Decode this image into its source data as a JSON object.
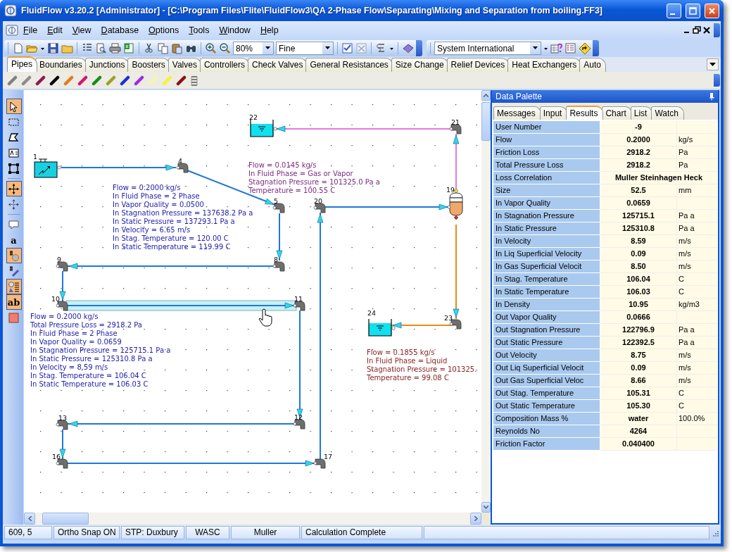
{
  "window": {
    "title": "FluidFlow v3.20.2 [Administrator] - [C:\\Program Files\\Flite\\FluidFlow3\\QA 2-Phase Flow\\Separating\\Mixing and Separation from boiling.FF3]"
  },
  "menu": [
    "File",
    "Edit",
    "View",
    "Database",
    "Options",
    "Tools",
    "Window",
    "Help"
  ],
  "toolbar": {
    "zoom": "80%",
    "grid": "Fine",
    "units": "System International"
  },
  "component_tabs": [
    {
      "label": "Pipes",
      "selected": true
    },
    {
      "label": "Boundaries",
      "selected": false
    },
    {
      "label": "Junctions",
      "selected": false
    },
    {
      "label": "Boosters",
      "selected": false
    },
    {
      "label": "Valves",
      "selected": false
    },
    {
      "label": "Controllers",
      "selected": false
    },
    {
      "label": "Check Valves",
      "selected": false
    },
    {
      "label": "General Resistances",
      "selected": false
    },
    {
      "label": "Size Change",
      "selected": false
    },
    {
      "label": "Relief Devices",
      "selected": false
    },
    {
      "label": "Heat Exchangers",
      "selected": false
    },
    {
      "label": "Auto",
      "selected": false
    }
  ],
  "pipe_palette": [
    {
      "color": "#808080"
    },
    {
      "color": "#8c8c8c"
    },
    {
      "color": "#8b1a4a"
    },
    {
      "color": "#000000"
    },
    {
      "color": "#e07b1c"
    },
    {
      "color": "#d4156f"
    },
    {
      "color": "#1a8a1a"
    },
    {
      "color": "#a0a020"
    },
    {
      "color": "#1f2fd0"
    },
    {
      "color": "#9b2de0"
    },
    {
      "color": "#f5f5b0"
    },
    {
      "color": "#f5f530"
    },
    {
      "color": "#8b1010"
    }
  ],
  "tools": [
    {
      "on": true
    },
    {
      "on": false
    },
    {
      "on": false
    },
    {
      "on": false
    },
    {
      "on": false
    },
    {
      "on": true
    },
    {
      "on": false
    },
    {
      "on": false
    },
    {
      "on": false,
      "glyph": "a"
    },
    {
      "on": true
    },
    {
      "on": false
    },
    {
      "on": true
    },
    {
      "on": true,
      "glyph": "ab"
    },
    {
      "on": false
    }
  ],
  "diagram": {
    "nodes": [
      {
        "kind": "source",
        "label": "1"
      },
      {
        "kind": "elbow",
        "label": "4"
      },
      {
        "kind": "elbow",
        "label": "5"
      },
      {
        "kind": "elbow",
        "label": "8"
      },
      {
        "kind": "elbow",
        "label": "9"
      },
      {
        "kind": "elbow",
        "label": "10"
      },
      {
        "kind": "elbow",
        "label": "11"
      },
      {
        "kind": "elbow",
        "label": "12"
      },
      {
        "kind": "elbow",
        "label": "13"
      },
      {
        "kind": "elbow",
        "label": "16"
      },
      {
        "kind": "elbow",
        "label": "17"
      },
      {
        "kind": "elbow",
        "label": "20"
      },
      {
        "kind": "separator",
        "label": "19"
      },
      {
        "kind": "elbow",
        "label": "21"
      },
      {
        "kind": "tank",
        "label": "22"
      },
      {
        "kind": "elbow",
        "label": "23"
      },
      {
        "kind": "tank",
        "label": "24"
      }
    ],
    "pipes": [
      {
        "color": "#1e78d7",
        "selected": false
      },
      {
        "color": "#1e78d7",
        "selected": false
      },
      {
        "color": "#1e78d7",
        "selected": false
      },
      {
        "color": "#1e78d7",
        "selected": false
      },
      {
        "color": "#1e78d7",
        "selected": false
      },
      {
        "color": "#1e78d7",
        "selected": true
      },
      {
        "color": "#1e78d7",
        "selected": false
      },
      {
        "color": "#1e78d7",
        "selected": false
      },
      {
        "color": "#1e78d7",
        "selected": false
      },
      {
        "color": "#1e78d7",
        "selected": false
      },
      {
        "color": "#1e78d7",
        "selected": false
      },
      {
        "color": "#1e78d7",
        "selected": false
      },
      {
        "color": "#e27be0",
        "selected": false
      },
      {
        "color": "#e27be0",
        "selected": false
      },
      {
        "color": "#e88a1a",
        "selected": false
      },
      {
        "color": "#e88a1a",
        "selected": false
      }
    ],
    "annotations": [
      {
        "color": "#1c1ca8",
        "lines": [
          "Flow = 0.2000 kg/s",
          "In Fluid Phase = 2 Phase",
          "In Vapor Quality = 0.0500",
          "In Stagnation Pressure = 137638.2 Pa a",
          "In Static Pressure = 137293.1 Pa a",
          "In Velocity = 6.65 m/s",
          "In Stag. Temperature = 120.00 C",
          "In Static Temperature = 119.99 C"
        ]
      },
      {
        "color": "#7a2a82",
        "lines": [
          "Flow = 0.0145 kg/s",
          "In Fluid Phase = Gas or Vapor",
          "Stagnation Pressure = 101325.0 Pa a",
          "Temperature = 100.55 C"
        ]
      },
      {
        "color": "#1c1ca8",
        "lines": [
          "Flow = 0.2000 kg/s",
          "Total Pressure Loss = 2918.2 Pa",
          "In Fluid Phase = 2 Phase",
          "In Vapor Quality = 0.0659",
          "In Stagnation Pressure = 125715.1 Pa a",
          "In Static Pressure = 125310.8 Pa a",
          "In Velocity = 8.59 m/s",
          "In Stag. Temperature = 106.04 C",
          "In Static Temperature = 106.03 C"
        ]
      },
      {
        "color": "#8b2323",
        "lines": [
          "Flow = 0.1855 kg/s",
          "In Fluid Phase = Liquid",
          "Stagnation Pressure = 101325.",
          "Temperature = 99.08 C"
        ]
      }
    ]
  },
  "data_palette": {
    "title": "Data Palette",
    "tabs": [
      {
        "label": "Messages",
        "selected": false
      },
      {
        "label": "Input",
        "selected": false
      },
      {
        "label": "Results",
        "selected": true
      },
      {
        "label": "Chart",
        "selected": false
      },
      {
        "label": "List",
        "selected": false
      },
      {
        "label": "Watch",
        "selected": false
      }
    ],
    "rows": [
      {
        "kind": "value",
        "label": "User Number",
        "value": "-9"
      },
      {
        "kind": "value",
        "label": "Flow",
        "value": "0.2000",
        "unit": "kg/s"
      },
      {
        "kind": "value",
        "label": "Friction Loss",
        "value": "2918.2",
        "unit": "Pa"
      },
      {
        "kind": "value",
        "label": "Total Pressure Loss",
        "value": "2918.2",
        "unit": "Pa"
      },
      {
        "kind": "wide",
        "label": "Loss Correlation",
        "value": "Muller Steinhagen Heck"
      },
      {
        "kind": "value",
        "label": "Size",
        "value": "52.5",
        "unit": "mm"
      },
      {
        "kind": "value",
        "label": "In Vapor Quality",
        "value": "0.0659"
      },
      {
        "kind": "value",
        "label": "In Stagnation Pressure",
        "value": "125715.1",
        "unit": "Pa a"
      },
      {
        "kind": "value",
        "label": "In Static Pressure",
        "value": "125310.8",
        "unit": "Pa a"
      },
      {
        "kind": "value",
        "label": "In Velocity",
        "value": "8.59",
        "unit": "m/s"
      },
      {
        "kind": "value",
        "label": "In Liq Superficial Velocity",
        "value": "0.09",
        "unit": "m/s"
      },
      {
        "kind": "value",
        "label": "In Gas Superficial Velocit",
        "value": "8.50",
        "unit": "m/s"
      },
      {
        "kind": "value",
        "label": "In Stag. Temperature",
        "value": "106.04",
        "unit": "C"
      },
      {
        "kind": "value",
        "label": "In Static Temperature",
        "value": "106.03",
        "unit": "C"
      },
      {
        "kind": "value",
        "label": "In Density",
        "value": "10.95",
        "unit": "kg/m3"
      },
      {
        "kind": "value",
        "label": "Out Vapor Quality",
        "value": "0.0666"
      },
      {
        "kind": "value",
        "label": "Out Stagnation Pressure",
        "value": "122796.9",
        "unit": "Pa a"
      },
      {
        "kind": "value",
        "label": "Out Static Pressure",
        "value": "122392.5",
        "unit": "Pa a"
      },
      {
        "kind": "value",
        "label": "Out Velocity",
        "value": "8.75",
        "unit": "m/s"
      },
      {
        "kind": "value",
        "label": "Out Liq Superficial Velocit",
        "value": "0.09",
        "unit": "m/s"
      },
      {
        "kind": "value",
        "label": "Out Gas Superficial Veloc",
        "value": "8.66",
        "unit": "m/s"
      },
      {
        "kind": "value",
        "label": "Out Stag. Temperature",
        "value": "105.31",
        "unit": "C"
      },
      {
        "kind": "value",
        "label": "Out Static Temperature",
        "value": "105.30",
        "unit": "C"
      },
      {
        "kind": "value",
        "label": "Composition Mass %",
        "value": "water",
        "unit": "100.0%"
      },
      {
        "kind": "value",
        "label": "Reynolds No",
        "value": "4264"
      },
      {
        "kind": "value",
        "label": "Friction Factor",
        "value": "0.040400"
      }
    ]
  },
  "status_bar": [
    "609, 5",
    "Ortho Snap ON",
    "STP: Duxbury",
    "WASC",
    "Muller",
    "Calculation Complete"
  ]
}
